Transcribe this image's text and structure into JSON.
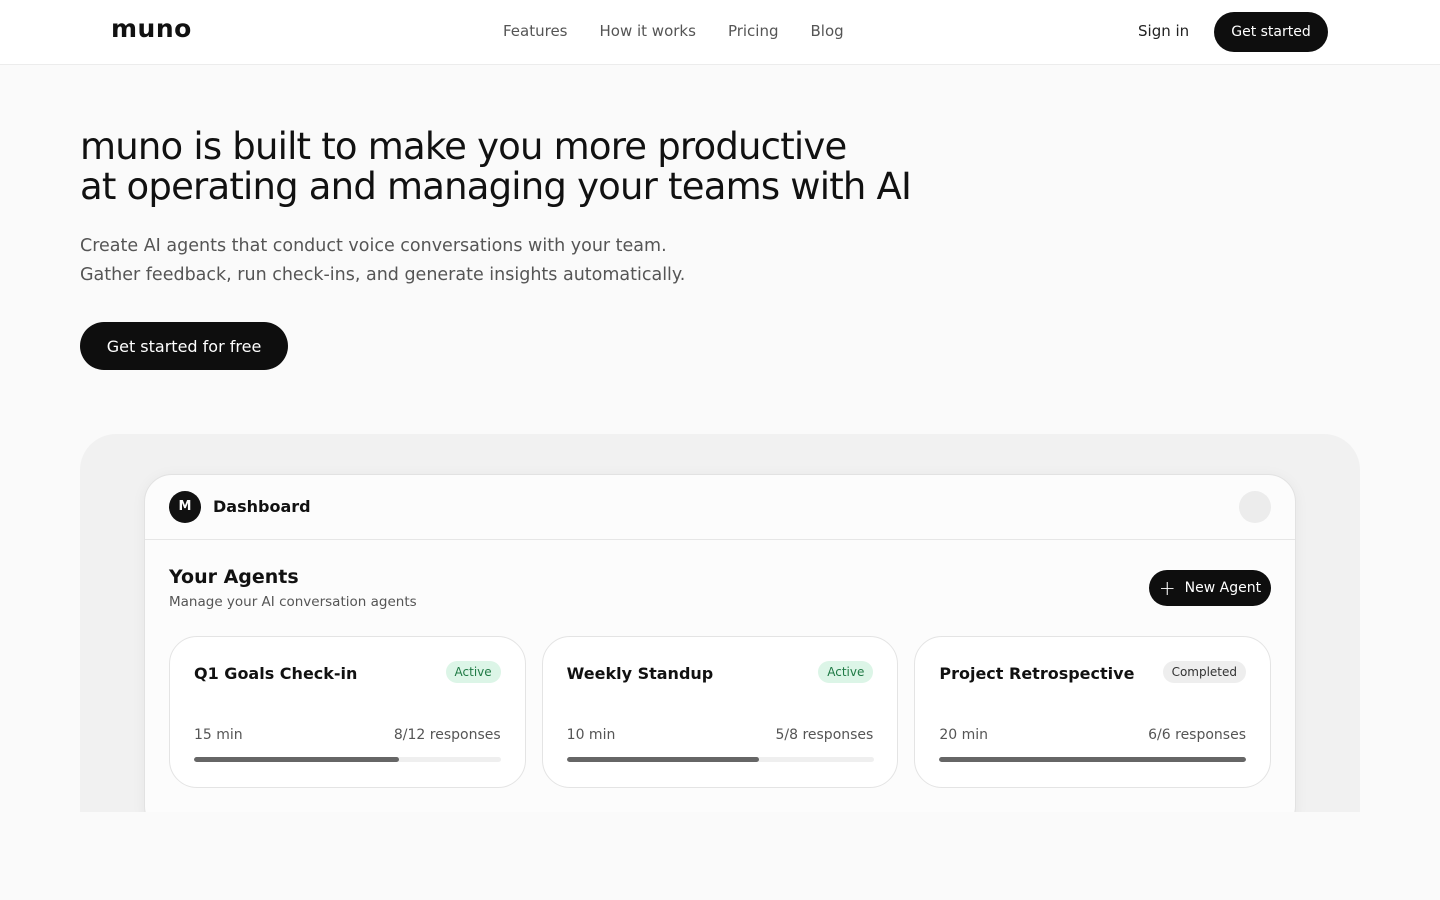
{
  "header": {
    "logo": "muno",
    "nav": [
      "Features",
      "How it works",
      "Pricing",
      "Blog"
    ],
    "sign_in": "Sign in",
    "get_started": "Get started"
  },
  "hero": {
    "title_line1": "muno is built to make you more productive",
    "title_line2": "at operating and managing your teams with AI",
    "sub_line1": "Create AI agents that conduct voice conversations with your team.",
    "sub_line2": "Gather feedback, run check-ins, and generate insights automatically.",
    "cta": "Get started for free"
  },
  "dashboard": {
    "avatar": "M",
    "title": "Dashboard",
    "section_title": "Your Agents",
    "section_sub": "Manage your AI conversation agents",
    "new_agent": "New Agent",
    "agents": [
      {
        "name": "Q1 Goals Check-in",
        "status": "Active",
        "status_type": "active",
        "duration": "15 min",
        "responses": "8/12 responses",
        "progress": 0.667
      },
      {
        "name": "Weekly Standup",
        "status": "Active",
        "status_type": "active",
        "duration": "10 min",
        "responses": "5/8 responses",
        "progress": 0.625
      },
      {
        "name": "Project Retrospective",
        "status": "Completed",
        "status_type": "completed",
        "duration": "20 min",
        "responses": "6/6 responses",
        "progress": 1.0
      }
    ]
  },
  "colors": {
    "brand_dark": "#0e0e0e",
    "active_badge_bg": "#dcf5e7",
    "active_badge_text": "#1f7a45",
    "progress_fill": "#666666"
  },
  "icons": {
    "new_agent": "plus-icon"
  }
}
